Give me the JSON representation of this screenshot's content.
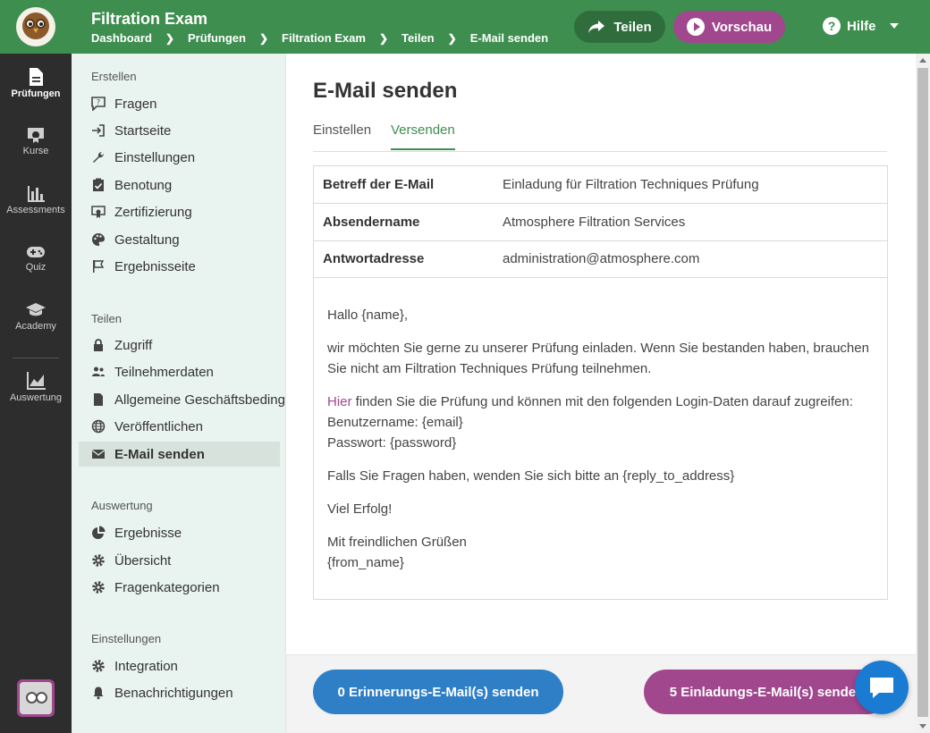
{
  "header": {
    "title": "Filtration Exam",
    "breadcrumb": [
      "Dashboard",
      "Prüfungen",
      "Filtration Exam",
      "Teilen",
      "E-Mail senden"
    ],
    "share_label": "Teilen",
    "preview_label": "Vorschau",
    "help_label": "Hilfe"
  },
  "rail": {
    "items": [
      {
        "label": "Prüfungen",
        "icon": "document-icon"
      },
      {
        "label": "Kurse",
        "icon": "certificate-icon"
      },
      {
        "label": "Assessments",
        "icon": "bar-chart-icon"
      },
      {
        "label": "Quiz",
        "icon": "gamepad-icon"
      },
      {
        "label": "Academy",
        "icon": "graduation-cap-icon"
      },
      {
        "label": "Auswertung",
        "icon": "area-chart-icon"
      }
    ]
  },
  "sidebar": {
    "sections": [
      {
        "title": "Erstellen",
        "items": [
          {
            "label": "Fragen",
            "icon": "question-bubble-icon"
          },
          {
            "label": "Startseite",
            "icon": "sign-in-icon"
          },
          {
            "label": "Einstellungen",
            "icon": "wrench-icon"
          },
          {
            "label": "Benotung",
            "icon": "clipboard-check-icon"
          },
          {
            "label": "Zertifizierung",
            "icon": "certificate-icon"
          },
          {
            "label": "Gestaltung",
            "icon": "palette-icon"
          },
          {
            "label": "Ergebnisseite",
            "icon": "flag-icon"
          }
        ]
      },
      {
        "title": "Teilen",
        "items": [
          {
            "label": "Zugriff",
            "icon": "lock-icon"
          },
          {
            "label": "Teilnehmerdaten",
            "icon": "users-icon"
          },
          {
            "label": "Allgemeine Geschäftsbedingungen",
            "icon": "file-icon"
          },
          {
            "label": "Veröffentlichen",
            "icon": "globe-icon"
          },
          {
            "label": "E-Mail senden",
            "icon": "envelope-icon"
          }
        ]
      },
      {
        "title": "Auswertung",
        "items": [
          {
            "label": "Ergebnisse",
            "icon": "pie-chart-icon"
          },
          {
            "label": "Übersicht",
            "icon": "cog-icon"
          },
          {
            "label": "Fragenkategorien",
            "icon": "cog-icon"
          }
        ]
      },
      {
        "title": "Einstellungen",
        "items": [
          {
            "label": "Integration",
            "icon": "cog-icon"
          },
          {
            "label": "Benachrichtigungen",
            "icon": "bell-icon"
          }
        ]
      }
    ]
  },
  "main": {
    "title": "E-Mail senden",
    "tabs": [
      {
        "label": "Einstellen"
      },
      {
        "label": "Versenden"
      }
    ],
    "fields": [
      {
        "key": "Betreff der E-Mail",
        "value": "Einladung für Filtration Techniques Prüfung"
      },
      {
        "key": "Absendername",
        "value": "Atmosphere Filtration Services"
      },
      {
        "key": "Antwortadresse",
        "value": "administration@atmosphere.com"
      }
    ],
    "message": {
      "greeting": "Hallo {name},",
      "p1": "wir möchten Sie gerne zu unserer Prüfung einladen. Wenn Sie bestanden haben, brauchen Sie nicht am Filtration Techniques Prüfung teilnehmen.",
      "link_text": "Hier",
      "p2_rest": " finden Sie die Prüfung und können mit den folgenden Login-Daten darauf zugreifen:",
      "username_line": "Benutzername: {email}",
      "password_line": "Passwort: {password}",
      "p3": "Falls Sie Fragen haben, wenden Sie sich bitte an {reply_to_address}",
      "p4": "Viel Erfolg!",
      "closing": "Mit freindlichen Grüßen",
      "signature": "{from_name}"
    }
  },
  "footer": {
    "reminder_label": "0 Erinnerungs-E-Mail(s) senden",
    "invite_label": "5 Einladungs-E-Mail(s) senden"
  },
  "colors": {
    "brand_green": "#3e8e4f",
    "accent_purple": "#a0478e",
    "reminder_blue": "#2f7fc7",
    "chat_blue": "#1a7bd3"
  }
}
